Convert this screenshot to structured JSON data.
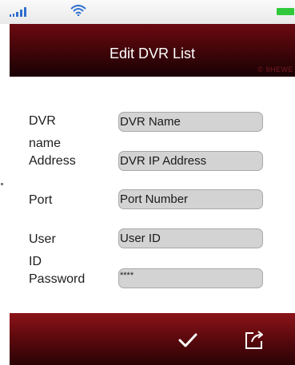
{
  "header": {
    "title": "Edit DVR List",
    "watermark": "© 9HEWE"
  },
  "form": {
    "fields": [
      {
        "label": "DVR name",
        "value": "DVR Name"
      },
      {
        "label": "Address",
        "value": "DVR IP Address"
      },
      {
        "label": "Port",
        "value": "Port Number"
      },
      {
        "label": "User ID",
        "value": "User ID"
      },
      {
        "label": "Password",
        "value": "****"
      }
    ]
  },
  "toolbar": {
    "confirm_icon": "checkmark-icon",
    "export_icon": "share-export-icon"
  },
  "status_bar": {
    "icons": [
      "signal-strength-icon",
      "wifi-icon",
      "battery-icon"
    ],
    "battery_color": "#31c93b"
  },
  "colors": {
    "header": "#3e0509",
    "toolbar": "#5f0a0e",
    "field_bg": "#d3d3d3"
  }
}
